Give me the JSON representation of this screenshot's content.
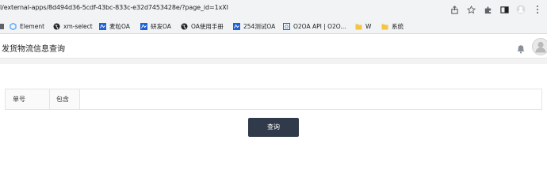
{
  "browser": {
    "url": "l/external-apps/8d494d36-5cdf-43bc-833c-e32d7453428e/?page_id=1xXI",
    "bookmarks": [
      {
        "label": "",
        "icon": "bookmark-cut-icon"
      },
      {
        "label": "Element",
        "icon": "element-logo-icon"
      },
      {
        "label": "xm-select",
        "icon": "globe-icon"
      },
      {
        "label": "麦粒OA",
        "icon": "oa-logo-icon"
      },
      {
        "label": "研发OA",
        "icon": "oa-logo-icon"
      },
      {
        "label": "OA使用手册",
        "icon": "globe-icon"
      },
      {
        "label": "254测试OA",
        "icon": "oa-logo-icon"
      },
      {
        "label": "O2OA API | O2O...",
        "icon": "o2oa-logo-icon"
      },
      {
        "label": "W",
        "icon": "folder-icon"
      },
      {
        "label": "系统",
        "icon": "folder-icon"
      }
    ]
  },
  "app": {
    "title": "发货物流信息查询"
  },
  "filter": {
    "field_label": "单号",
    "operator_label": "包含",
    "value": ""
  },
  "actions": {
    "query_label": "查询"
  },
  "colors": {
    "button_bg": "#303a4a",
    "chrome_bg": "#f1f3f4"
  }
}
